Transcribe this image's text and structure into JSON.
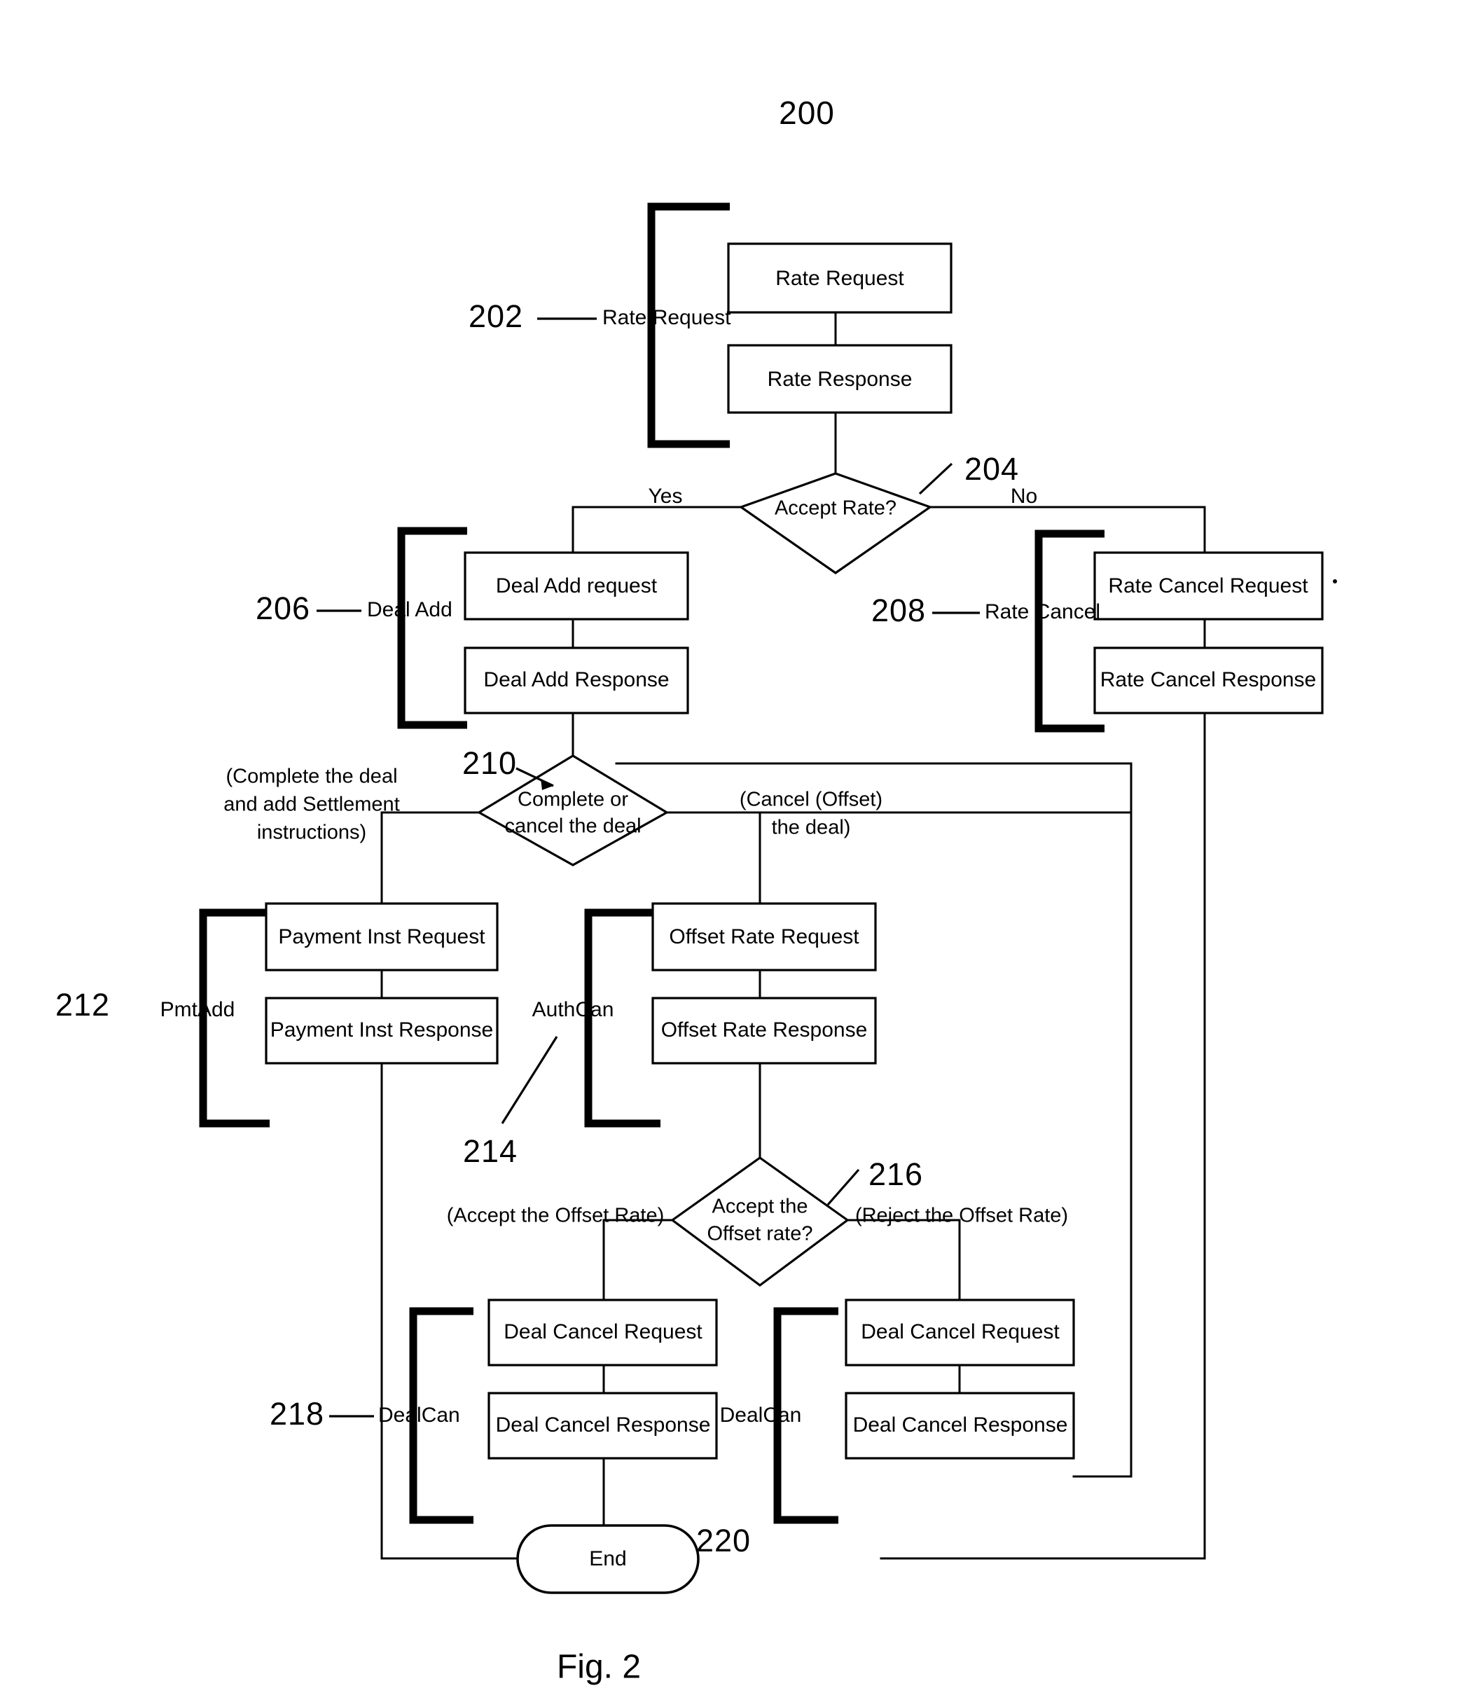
{
  "figure": {
    "number_label": "200",
    "caption": "Fig. 2"
  },
  "nodes": {
    "rate_request": "Rate Request",
    "rate_response": "Rate Response",
    "accept_rate_q": "Accept Rate?",
    "deal_add_request": "Deal Add request",
    "deal_add_response": "Deal Add Response",
    "rate_cancel_request": "Rate Cancel Request",
    "rate_cancel_response": "Rate Cancel Response",
    "complete_or_cancel_q_line1": "Complete or",
    "complete_or_cancel_q_line2": "cancel the deal",
    "payment_inst_request": "Payment Inst Request",
    "payment_inst_response": "Payment Inst Response",
    "offset_rate_request": "Offset Rate Request",
    "offset_rate_response": "Offset Rate Response",
    "accept_offset_q_line1": "Accept the",
    "accept_offset_q_line2": "Offset rate?",
    "deal_cancel_request_left": "Deal Cancel Request",
    "deal_cancel_response_left": "Deal Cancel Response",
    "deal_cancel_request_right": "Deal Cancel Request",
    "deal_cancel_response_right": "Deal Cancel Response",
    "end": "End"
  },
  "reference_numerals": {
    "n202": "202",
    "n204": "204",
    "n206": "206",
    "n208": "208",
    "n210": "210",
    "n212": "212",
    "n214": "214",
    "n216": "216",
    "n218": "218",
    "n220": "220"
  },
  "group_labels": {
    "rate_request_group": "Rate Request",
    "deal_add_group": "Deal Add",
    "rate_cancel_group": "Rate Cancel",
    "pmt_add_group": "PmtAdd",
    "auth_can_group": "AuthCan",
    "deal_can_group_left": "DealCan",
    "deal_can_group_right": "DealCan"
  },
  "branch_labels": {
    "accept_rate_yes": "Yes",
    "accept_rate_no": "No",
    "complete_deal_line1": "(Complete the deal",
    "complete_deal_line2": "and add Settlement",
    "complete_deal_line3": "instructions)",
    "cancel_offset_line1": "(Cancel (Offset)",
    "cancel_offset_line2": "the deal)",
    "accept_offset_rate": "(Accept the Offset Rate)",
    "reject_offset_rate": "(Reject  the Offset Rate)"
  },
  "chart_data": {
    "type": "diagram",
    "title": "200",
    "subtype": "flowchart",
    "steps": [
      {
        "ref": "202",
        "group": "Rate Request",
        "boxes": [
          "Rate Request",
          "Rate Response"
        ]
      },
      {
        "ref": "204",
        "decision": "Accept Rate?",
        "branches": [
          "Yes",
          "No"
        ]
      },
      {
        "ref": "206",
        "group": "Deal Add",
        "boxes": [
          "Deal Add request",
          "Deal Add Response"
        ]
      },
      {
        "ref": "208",
        "group": "Rate Cancel",
        "boxes": [
          "Rate Cancel Request",
          "Rate Cancel Response"
        ]
      },
      {
        "ref": "210",
        "decision": "Complete or cancel the deal",
        "branches": [
          "(Complete the deal and add Settlement instructions)",
          "(Cancel (Offset) the deal)"
        ]
      },
      {
        "ref": "212",
        "group": "PmtAdd",
        "boxes": [
          "Payment Inst Request",
          "Payment Inst Response"
        ]
      },
      {
        "ref": "214",
        "group": "AuthCan",
        "boxes": [
          "Offset Rate Request",
          "Offset Rate Response"
        ]
      },
      {
        "ref": "216",
        "decision": "Accept the Offset rate?",
        "branches": [
          "(Accept the Offset Rate)",
          "(Reject  the Offset Rate)"
        ]
      },
      {
        "ref": "218",
        "group": "DealCan",
        "boxes": [
          "Deal Cancel Request",
          "Deal Cancel Response"
        ]
      },
      {
        "ref": "220",
        "group": "DealCan",
        "boxes": [
          "Deal Cancel Request",
          "Deal Cancel Response"
        ]
      },
      {
        "ref": "",
        "terminal": "End"
      }
    ]
  }
}
